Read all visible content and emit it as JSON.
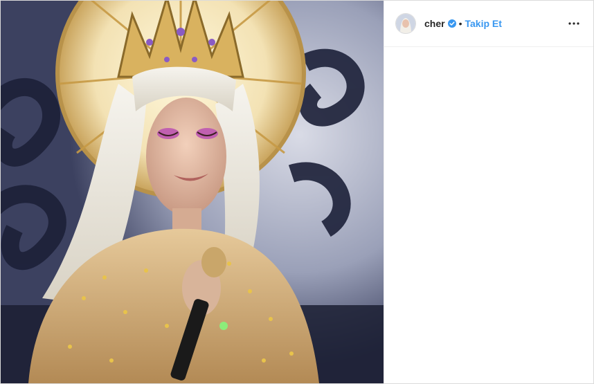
{
  "post": {
    "username": "cher",
    "separator": "•",
    "follow_label": "Takip Et",
    "verified_icon": "verified-badge-icon",
    "more_icon": "more-options-icon",
    "colors": {
      "follow": "#3897f0",
      "verified": "#3897f0",
      "text": "#262626",
      "border": "#efefef"
    }
  }
}
